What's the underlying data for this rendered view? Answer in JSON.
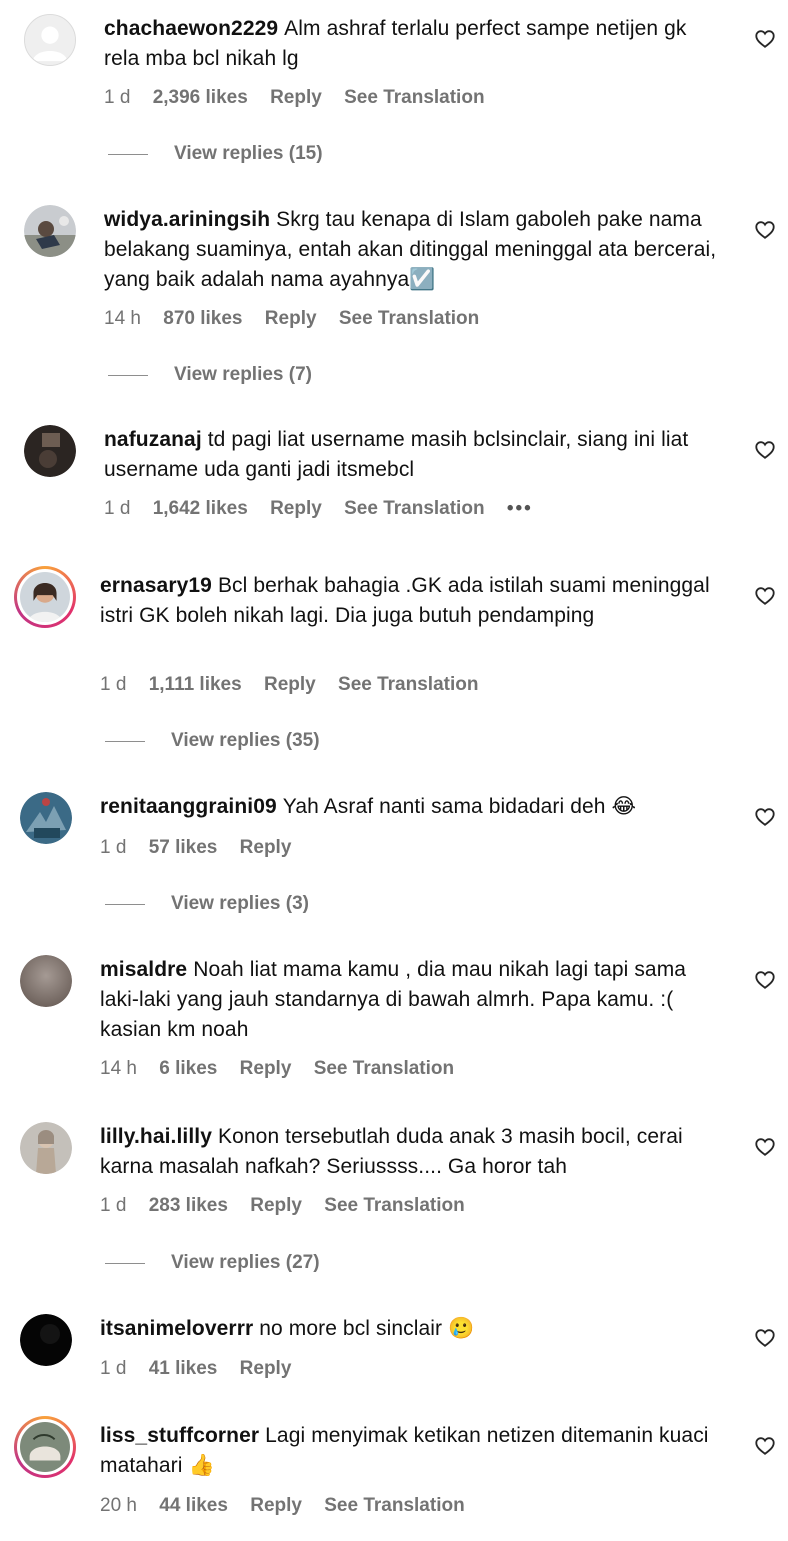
{
  "colors": {
    "meta_text": "#737373",
    "text": "#111111",
    "ring": "#e1306c"
  },
  "comments": [
    {
      "username": "chachaewon2229",
      "text": "Alm ashraf terlalu perfect sampe netijen gk rela mba bcl nikah lg",
      "time": "1 d",
      "likes": "2,396 likes",
      "reply": "Reply",
      "translate": "See Translation",
      "view_replies": "View replies (15)"
    },
    {
      "username": "widya.ariningsih",
      "text": "Skrg tau kenapa di Islam gaboleh pake nama belakang suaminya, entah akan ditinggal meninggal ata bercerai, yang baik adalah nama ayahnya☑️",
      "time": "14 h",
      "likes": "870 likes",
      "reply": "Reply",
      "translate": "See Translation",
      "view_replies": "View replies (7)"
    },
    {
      "username": "nafuzanaj",
      "text": "td pagi liat username masih bclsinclair, siang ini liat username uda ganti jadi itsmebcl",
      "time": "1 d",
      "likes": "1,642 likes",
      "reply": "Reply",
      "translate": "See Translation",
      "more": "•••"
    },
    {
      "username": "ernasary19",
      "text": "Bcl berhak bahagia .GK ada istilah suami meninggal istri GK boleh nikah lagi. Dia juga butuh pendamping",
      "time": "1 d",
      "likes": "1,111 likes",
      "reply": "Reply",
      "translate": "See Translation",
      "view_replies": "View replies (35)"
    },
    {
      "username": "renitaanggraini09",
      "text": "Yah Asraf nanti sama bidadari deh 😂",
      "time": "1 d",
      "likes": "57 likes",
      "reply": "Reply",
      "view_replies": "View replies (3)"
    },
    {
      "username": "misaldre",
      "text": "Noah liat mama kamu , dia mau nikah lagi tapi sama laki-laki yang jauh standarnya di bawah almrh. Papa kamu. :( kasian km noah",
      "time": "14 h",
      "likes": "6 likes",
      "reply": "Reply",
      "translate": "See Translation"
    },
    {
      "username": "lilly.hai.lilly",
      "text": "Konon tersebutlah duda anak 3 masih bocil, cerai karna masalah nafkah? Seriussss.... Ga horor tah",
      "time": "1 d",
      "likes": "283 likes",
      "reply": "Reply",
      "translate": "See Translation",
      "view_replies": "View replies (27)"
    },
    {
      "username": "itsanimeloverrr",
      "text": "no more bcl sinclair 🥲",
      "time": "1 d",
      "likes": "41 likes",
      "reply": "Reply"
    },
    {
      "username": "liss_stuffcorner",
      "text": "Lagi menyimak ketikan netizen ditemanin kuaci matahari 👍",
      "time": "20 h",
      "likes": "44 likes",
      "reply": "Reply",
      "translate": "See Translation"
    }
  ]
}
